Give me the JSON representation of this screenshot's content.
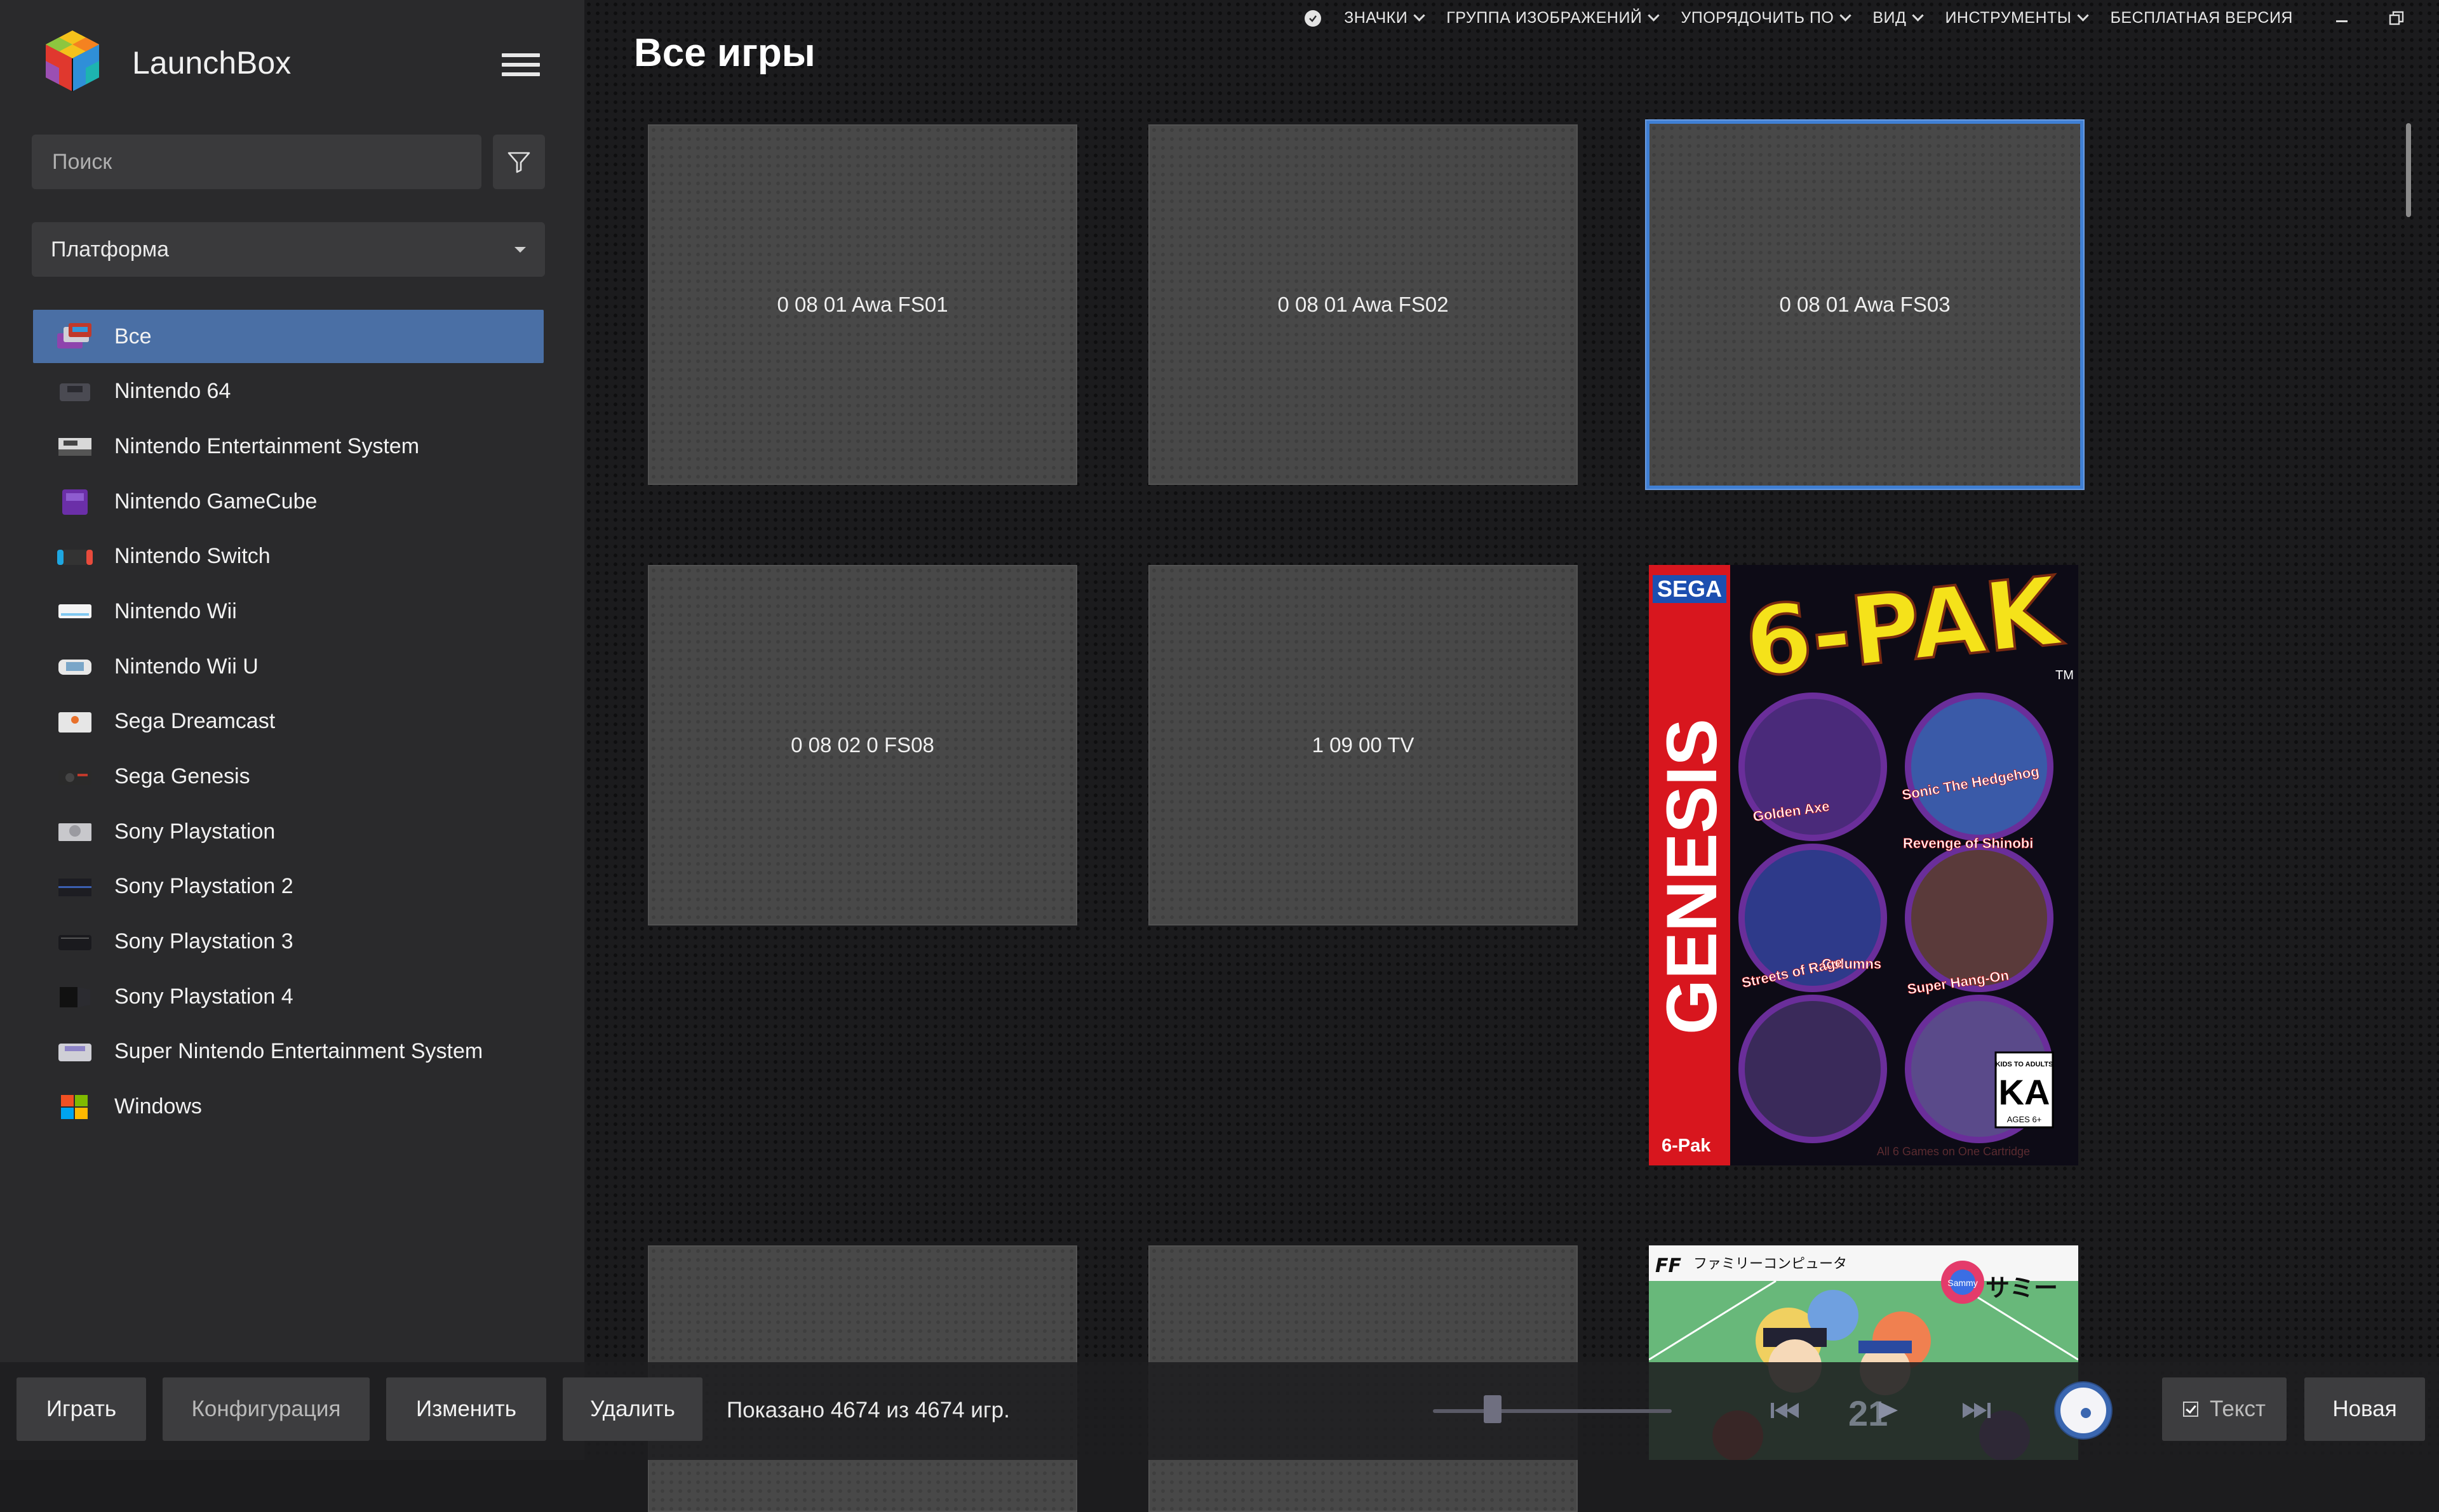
{
  "app": {
    "title": "LaunchBox",
    "search_placeholder": "Поиск",
    "platform_select_value": "Платформа"
  },
  "platforms": [
    {
      "label": "Все",
      "icon": "all-platforms-icon",
      "selected": true
    },
    {
      "label": "Nintendo 64",
      "icon": "nintendo-64-icon"
    },
    {
      "label": "Nintendo Entertainment System",
      "icon": "nes-icon"
    },
    {
      "label": "Nintendo GameCube",
      "icon": "gamecube-icon"
    },
    {
      "label": "Nintendo Switch",
      "icon": "switch-icon"
    },
    {
      "label": "Nintendo Wii",
      "icon": "wii-icon"
    },
    {
      "label": "Nintendo Wii U",
      "icon": "wii-u-icon"
    },
    {
      "label": "Sega Dreamcast",
      "icon": "dreamcast-icon"
    },
    {
      "label": "Sega Genesis",
      "icon": "genesis-icon"
    },
    {
      "label": "Sony Playstation",
      "icon": "playstation-icon"
    },
    {
      "label": "Sony Playstation 2",
      "icon": "playstation-2-icon"
    },
    {
      "label": "Sony Playstation 3",
      "icon": "playstation-3-icon"
    },
    {
      "label": "Sony Playstation 4",
      "icon": "playstation-4-icon"
    },
    {
      "label": "Super Nintendo Entertainment System",
      "icon": "snes-icon"
    },
    {
      "label": "Windows",
      "icon": "windows-icon"
    }
  ],
  "header": {
    "page_title": "Все игры",
    "menus": [
      "ЗНАЧКИ",
      "ГРУППА ИЗОБРАЖЕНИЙ",
      "УПОРЯДОЧИТЬ ПО",
      "ВИД",
      "ИНСТРУМЕНТЫ"
    ],
    "free_version": "БЕСПЛАТНАЯ ВЕРСИЯ"
  },
  "games": [
    {
      "title": "0 08 01 Awa FS01",
      "has_image": false
    },
    {
      "title": "0 08 01 Awa FS02",
      "has_image": false
    },
    {
      "title": "0 08 01 Awa FS03",
      "has_image": false,
      "selected": true
    },
    {
      "title": "0 08 02 0 FS08",
      "has_image": false
    },
    {
      "title": "1 09 00 TV",
      "has_image": false
    },
    {
      "title": "6-Pak",
      "has_image": true
    }
  ],
  "box_art_6pak": {
    "brand": "SEGA",
    "console": "GENESIS",
    "logo": "6-PAK",
    "trademark": "TM",
    "included_games": [
      "Golden Axe",
      "Sonic The Hedgehog",
      "Revenge of Shinobi",
      "Columns",
      "Streets of Rage",
      "Super Hang-On"
    ],
    "rating": "KA",
    "rating_top": "KIDS TO ADULTS",
    "rating_bottom": "AGES 6+",
    "footer": "All 6 Games on One Cartridge"
  },
  "box_art_famicom": {
    "console": "ファミリーコンピュータ",
    "publisher": "サミー",
    "publisher_logo": "Sammy"
  },
  "bottom_bar": {
    "play": "Играть",
    "config": "Конфигурация",
    "edit": "Изменить",
    "delete": "Удалить",
    "status": "Показано 4674 из 4674 игр.",
    "media_number": "21",
    "text_toggle": "Текст",
    "new": "Новая"
  },
  "colors": {
    "selection": "#4a6fa5",
    "tile_border_selected": "#3f7fd4",
    "sidebar_bg": "#2a2a2c",
    "main_bg": "#1b1b1d"
  }
}
